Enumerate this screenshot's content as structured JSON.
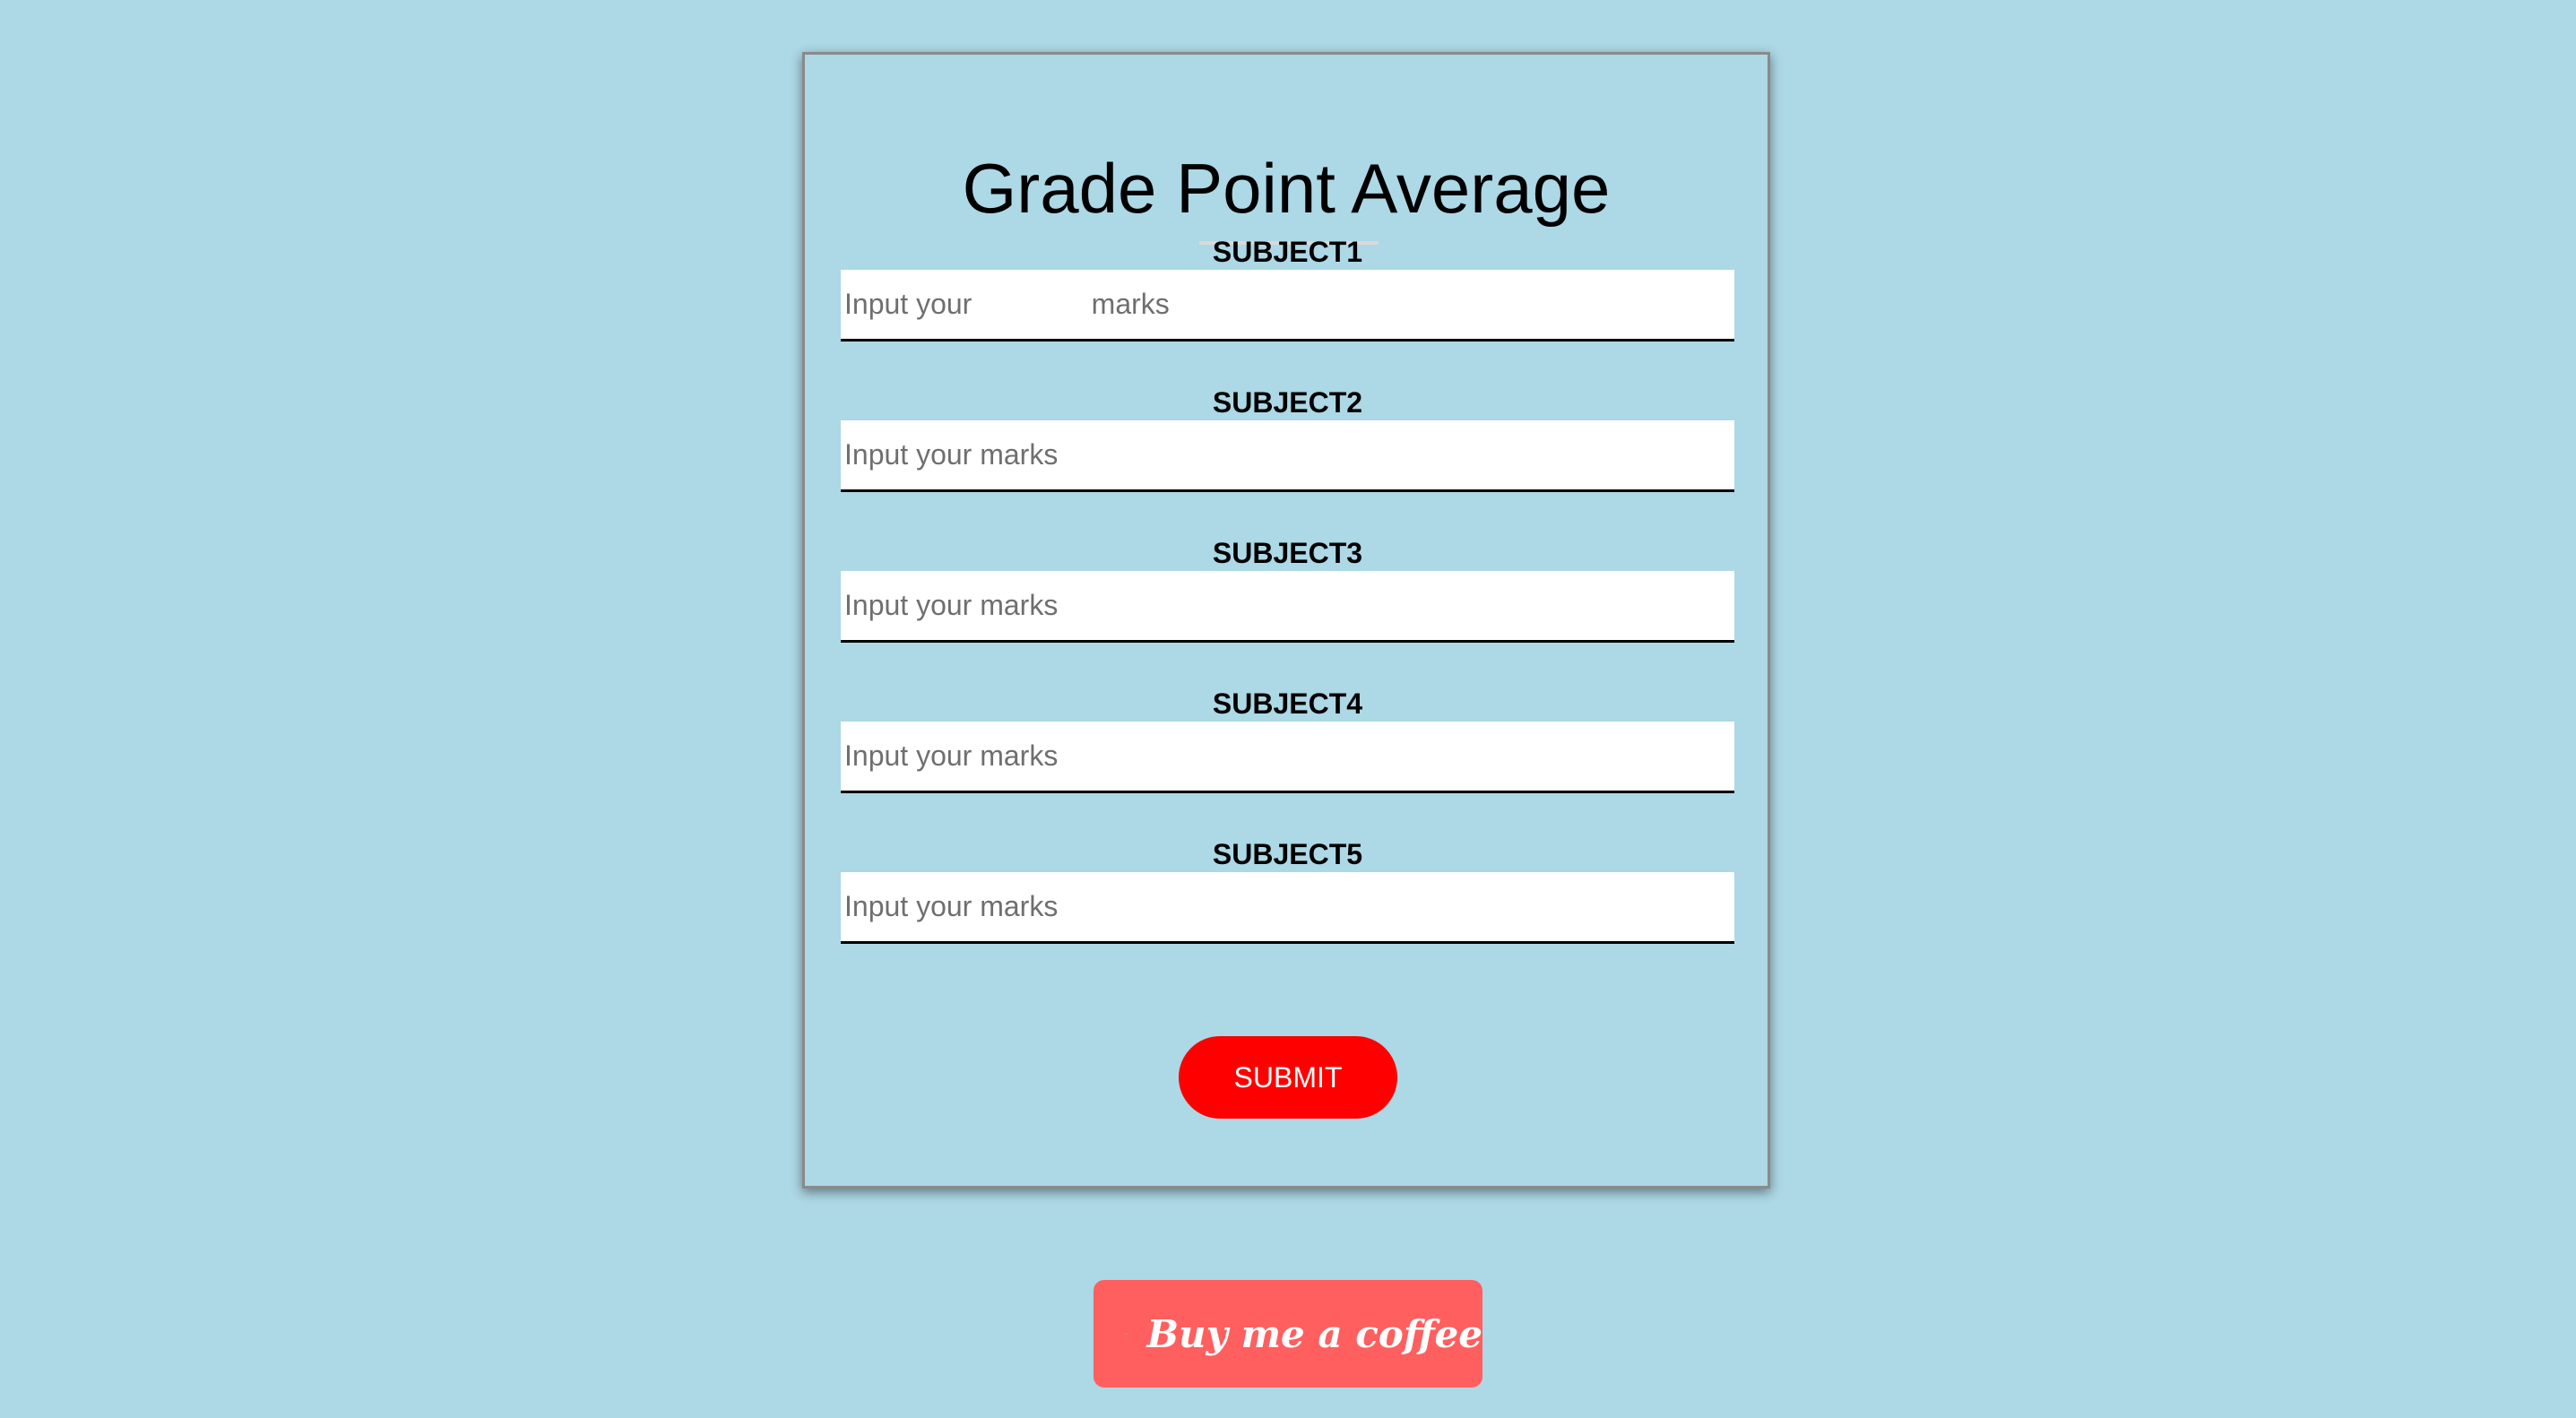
{
  "form": {
    "title": "Grade Point Average",
    "subjects": [
      {
        "label": "SUBJECT1",
        "placeholder": "Input your               marks",
        "value": ""
      },
      {
        "label": "SUBJECT2",
        "placeholder": "Input your marks",
        "value": ""
      },
      {
        "label": "SUBJECT3",
        "placeholder": "Input your marks",
        "value": ""
      },
      {
        "label": "SUBJECT4",
        "placeholder": "Input your marks",
        "value": ""
      },
      {
        "label": "SUBJECT5",
        "placeholder": "Input your marks",
        "value": ""
      }
    ],
    "submit_label": "SUBMIT"
  },
  "coffee_button": {
    "label": "Buy me a coffee",
    "icon": "coffee-cup-icon"
  },
  "colors": {
    "page_background": "#add8e6",
    "submit_button": "#ff0000",
    "coffee_button": "#ff5f5f"
  }
}
